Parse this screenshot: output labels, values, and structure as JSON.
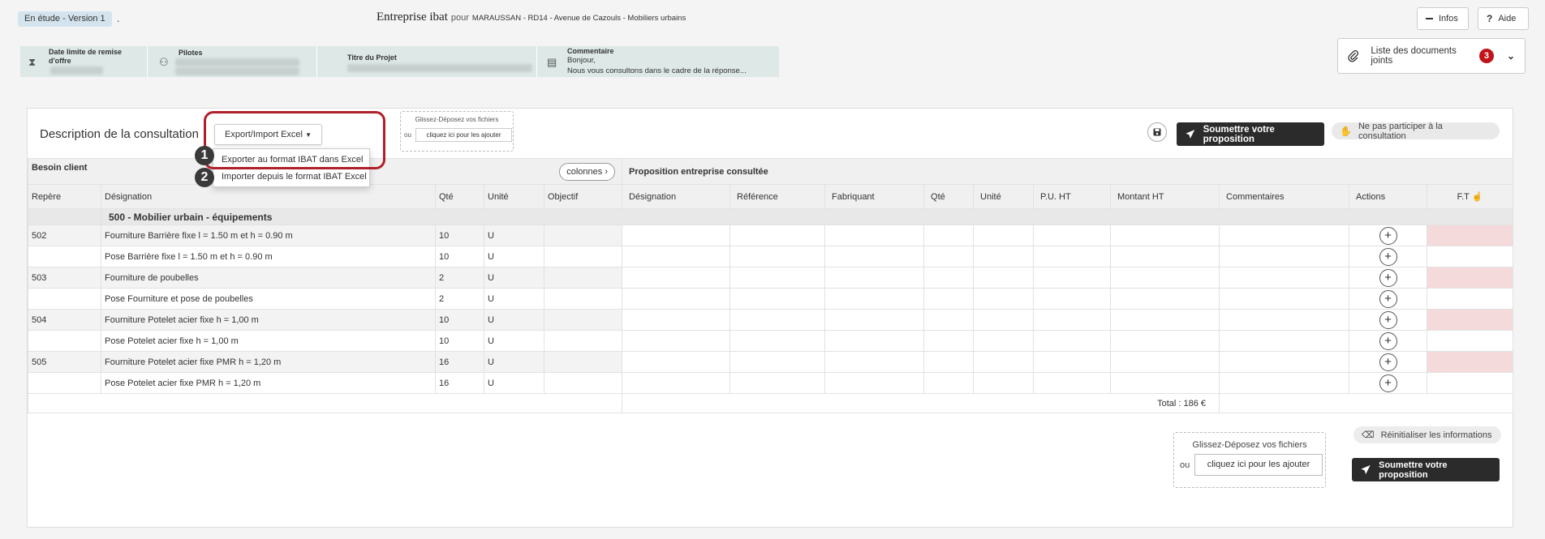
{
  "header": {
    "status": "En étude - Version 1",
    "status_sep": ".",
    "title_company": "Entreprise ibat",
    "title_for": "pour",
    "title_project": "MARAUSSAN - RD14 - Avenue de Cazouls - Mobiliers urbains",
    "infos_label": "Infos",
    "aide_label": "Aide"
  },
  "info_band": {
    "deadline_label": "Date limite de remise d'offre",
    "pilots_label": "Pilotes",
    "project_title_label": "Titre du Projet",
    "comment_label": "Commentaire",
    "comment_line1": "Bonjour,",
    "comment_line2": "Nous vous consultons dans le cadre de la réponse..."
  },
  "docs": {
    "label": "Liste des documents joints",
    "count": "3"
  },
  "toolbar": {
    "section_title": "Description de la consultation",
    "export_label": "Export/Import Excel",
    "export_menu": [
      "Exporter au format IBAT dans Excel",
      "Importer depuis le format IBAT Excel"
    ],
    "steps": [
      "1",
      "2"
    ],
    "dropzone_label": "Glissez-Déposez vos fichiers",
    "dropzone_or": "ou",
    "dropzone_btn": "cliquez ici pour les ajouter",
    "submit_label": "Soumettre votre proposition",
    "decline_label": "Ne pas participer à la consultation"
  },
  "table": {
    "group_client": "Besoin client",
    "group_company": "Proposition entreprise consultée",
    "colonnes_label": "colonnes",
    "columns": [
      "Repère",
      "Désignation",
      "Qté",
      "Unité",
      "Objectif",
      "Désignation",
      "Référence",
      "Fabriquant",
      "Qté",
      "Unité",
      "P.U. HT",
      "Montant HT",
      "Commentaires",
      "Actions",
      "F.T"
    ],
    "section": "500 - Mobilier urbain - équipements",
    "rows": [
      {
        "repere": "502",
        "designation": "Fourniture Barrière fixe l = 1.50 m et h = 0.90 m",
        "qte": "10",
        "unite": "U"
      },
      {
        "repere": "",
        "designation": "Pose Barrière fixe l = 1.50 m et h = 0.90 m",
        "qte": "10",
        "unite": "U"
      },
      {
        "repere": "503",
        "designation": "Fourniture de poubelles",
        "qte": "2",
        "unite": "U"
      },
      {
        "repere": "",
        "designation": "Pose Fourniture et pose de poubelles",
        "qte": "2",
        "unite": "U"
      },
      {
        "repere": "504",
        "designation": "Fourniture Potelet acier fixe h = 1,00 m",
        "qte": "10",
        "unite": "U"
      },
      {
        "repere": "",
        "designation": "Pose Potelet acier fixe h = 1,00 m",
        "qte": "10",
        "unite": "U"
      },
      {
        "repere": "505",
        "designation": "Fourniture Potelet acier fixe PMR h = 1,20 m",
        "qte": "16",
        "unite": "U"
      },
      {
        "repere": "",
        "designation": " Pose Potelet acier fixe PMR h = 1,20 m",
        "qte": "16",
        "unite": "U"
      }
    ],
    "total": "Total : 186 €"
  },
  "bottom": {
    "dropzone_label": "Glissez-Déposez vos fichiers",
    "dropzone_or": "ou",
    "dropzone_btn": "cliquez ici pour les ajouter",
    "reset_label": "Réinitialiser les informations",
    "submit_label": "Soumettre votre proposition"
  }
}
